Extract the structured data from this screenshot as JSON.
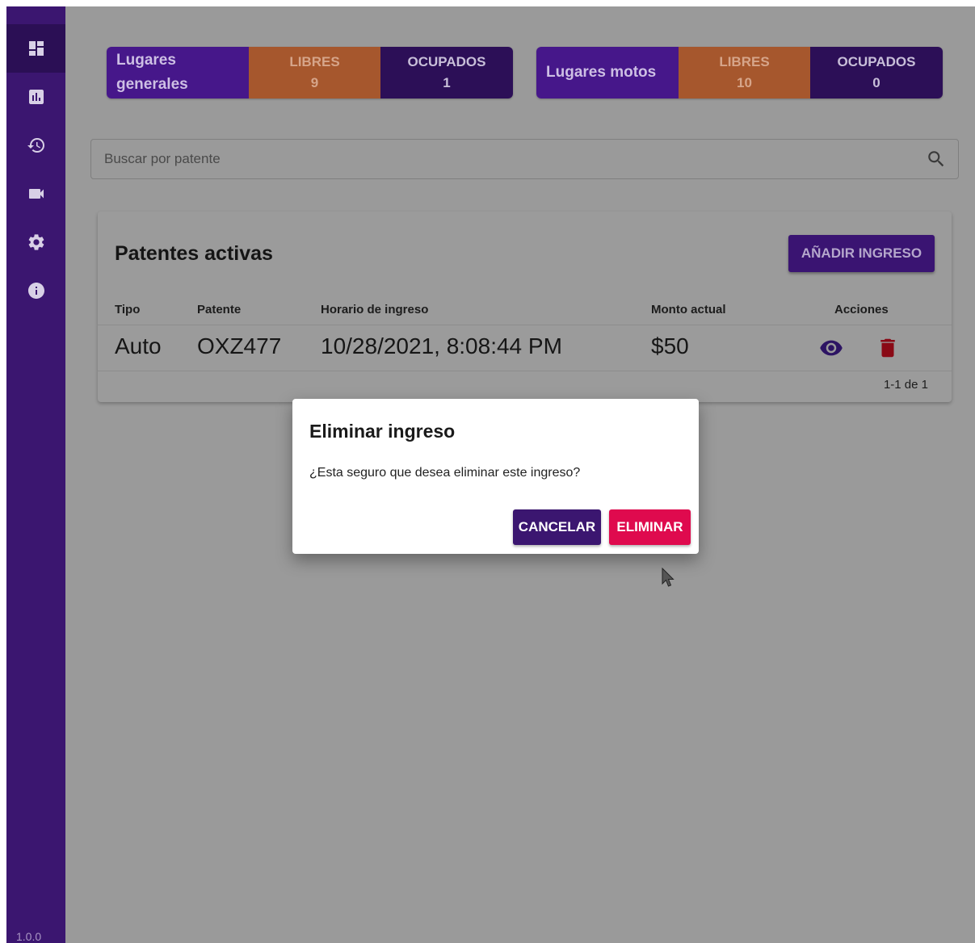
{
  "sidebar": {
    "items": [
      {
        "name": "dashboard-icon",
        "active": true
      },
      {
        "name": "reports-icon"
      },
      {
        "name": "history-icon"
      },
      {
        "name": "camera-icon"
      },
      {
        "name": "settings-icon"
      },
      {
        "name": "info-icon"
      }
    ],
    "version": "1.0.0"
  },
  "stats": {
    "general": {
      "label": "Lugares generales",
      "free_label": "LIBRES",
      "free_value": "9",
      "occupied_label": "OCUPADOS",
      "occupied_value": "1"
    },
    "motos": {
      "label": "Lugares motos",
      "free_label": "LIBRES",
      "free_value": "10",
      "occupied_label": "OCUPADOS",
      "occupied_value": "0"
    }
  },
  "search": {
    "placeholder": "Buscar por patente",
    "value": ""
  },
  "active_plates": {
    "title": "Patentes activas",
    "add_button": "AÑADIR INGRESO",
    "columns": {
      "tipo": "Tipo",
      "patente": "Patente",
      "horario": "Horario de ingreso",
      "monto": "Monto actual",
      "acciones": "Acciones"
    },
    "rows": [
      {
        "tipo": "Auto",
        "patente": "OXZ477",
        "horario": "10/28/2021, 8:08:44 PM",
        "monto": "$50"
      }
    ],
    "pagination": "1-1 de 1"
  },
  "dialog": {
    "title": "Eliminar ingreso",
    "message": "¿Esta seguro que desea eliminar este ingreso?",
    "cancel_label": "CANCELAR",
    "confirm_label": "ELIMINAR"
  },
  "colors": {
    "primary": "#46178a",
    "free": "#a6572d",
    "occupied": "#2c0f57",
    "danger": "#df0a4e"
  }
}
